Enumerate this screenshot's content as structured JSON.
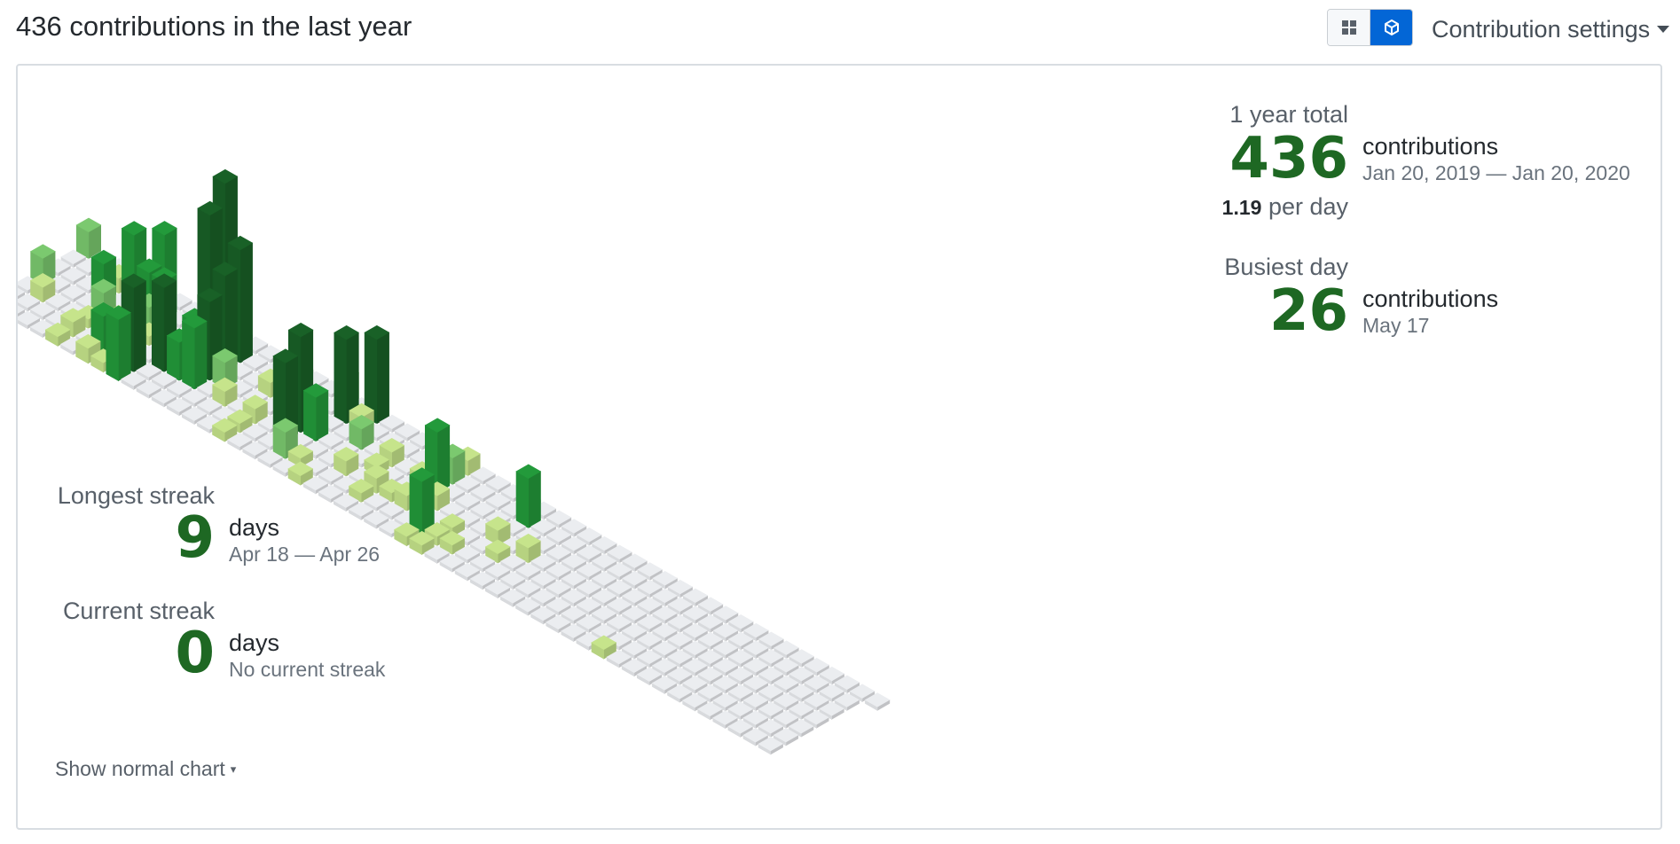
{
  "header": {
    "title": "436 contributions in the last year",
    "settings_label": "Contribution settings",
    "view_toggle": {
      "active": "isometric"
    }
  },
  "summary": {
    "year_label": "1 year total",
    "year_total": "436",
    "year_unit": "contributions",
    "year_range": "Jan 20, 2019 — Jan 20, 2020",
    "per_day_value": "1.19",
    "per_day_suffix": "per day",
    "busiest_label": "Busiest day",
    "busiest_count": "26",
    "busiest_unit": "contributions",
    "busiest_date": "May 17"
  },
  "streaks": {
    "longest_label": "Longest streak",
    "longest_value": "9",
    "longest_unit": "days",
    "longest_range": "Apr 18 — Apr 26",
    "current_label": "Current streak",
    "current_value": "0",
    "current_unit": "days",
    "current_sub": "No current streak"
  },
  "footer": {
    "show_normal_label": "Show normal chart"
  },
  "colors": {
    "empty": "#ebedf0",
    "level1": "#c6e48b",
    "level2": "#7bc96f",
    "level3": "#239a3b",
    "level4": "#196127",
    "accent": "#0366d6",
    "number": "#1e6823"
  },
  "chart_data": {
    "type": "isometric-3d-bar",
    "weeks": 53,
    "days": 7,
    "cells": [
      {
        "w": 0,
        "d": 0,
        "v": 4
      },
      {
        "w": 0,
        "d": 3,
        "v": 4
      },
      {
        "w": 1,
        "d": 4,
        "v": 2
      },
      {
        "w": 3,
        "d": 2,
        "v": 6
      },
      {
        "w": 3,
        "d": 1,
        "v": 2
      },
      {
        "w": 4,
        "d": 3,
        "v": 4
      },
      {
        "w": 4,
        "d": 4,
        "v": 1
      },
      {
        "w": 4,
        "d": 5,
        "v": 2
      },
      {
        "w": 4,
        "d": 6,
        "v": 1
      },
      {
        "w": 4,
        "d": 1,
        "v": 11
      },
      {
        "w": 5,
        "d": 0,
        "v": 11
      },
      {
        "w": 5,
        "d": 1,
        "v": 6
      },
      {
        "w": 5,
        "d": 3,
        "v": 1
      },
      {
        "w": 6,
        "d": 1,
        "v": 6
      },
      {
        "w": 6,
        "d": 2,
        "v": 3
      },
      {
        "w": 5,
        "d": 4,
        "v": 2
      },
      {
        "w": 6,
        "d": 4,
        "v": 3
      },
      {
        "w": 6,
        "d": 5,
        "v": 6
      },
      {
        "w": 6,
        "d": 6,
        "v": 2
      },
      {
        "w": 7,
        "d": 3,
        "v": 1
      },
      {
        "w": 7,
        "d": 4,
        "v": 2
      },
      {
        "w": 7,
        "d": 5,
        "v": 1
      },
      {
        "w": 7,
        "d": 6,
        "v": 1
      },
      {
        "w": 8,
        "d": 3,
        "v": 8
      },
      {
        "w": 8,
        "d": 5,
        "v": 14
      },
      {
        "w": 8,
        "d": 6,
        "v": 10
      },
      {
        "w": 9,
        "d": 0,
        "v": 26
      },
      {
        "w": 9,
        "d": 1,
        "v": 22
      },
      {
        "w": 9,
        "d": 4,
        "v": 14
      },
      {
        "w": 10,
        "d": 3,
        "v": 8
      },
      {
        "w": 10,
        "d": 4,
        "v": 6
      },
      {
        "w": 11,
        "d": 1,
        "v": 19
      },
      {
        "w": 11,
        "d": 2,
        "v": 16
      },
      {
        "w": 11,
        "d": 3,
        "v": 13
      },
      {
        "w": 11,
        "d": 4,
        "v": 10
      },
      {
        "w": 12,
        "d": 3,
        "v": 4
      },
      {
        "w": 13,
        "d": 4,
        "v": 2
      },
      {
        "w": 14,
        "d": 1,
        "v": 2
      },
      {
        "w": 14,
        "d": 2,
        "v": 2
      },
      {
        "w": 15,
        "d": 4,
        "v": 2
      },
      {
        "w": 15,
        "d": 5,
        "v": 1
      },
      {
        "w": 15,
        "d": 6,
        "v": 1
      },
      {
        "w": 17,
        "d": 0,
        "v": 4
      },
      {
        "w": 17,
        "d": 3,
        "v": 16
      },
      {
        "w": 17,
        "d": 4,
        "v": 13
      },
      {
        "w": 18,
        "d": 1,
        "v": 14
      },
      {
        "w": 18,
        "d": 3,
        "v": 7
      },
      {
        "w": 18,
        "d": 5,
        "v": 4
      },
      {
        "w": 19,
        "d": 0,
        "v": 14
      },
      {
        "w": 19,
        "d": 1,
        "v": 2
      },
      {
        "w": 19,
        "d": 5,
        "v": 1
      },
      {
        "w": 20,
        "d": 2,
        "v": 3
      },
      {
        "w": 20,
        "d": 6,
        "v": 1
      },
      {
        "w": 21,
        "d": 4,
        "v": 2
      },
      {
        "w": 22,
        "d": 2,
        "v": 2
      },
      {
        "w": 22,
        "d": 3,
        "v": 1
      },
      {
        "w": 23,
        "d": 4,
        "v": 2
      },
      {
        "w": 23,
        "d": 5,
        "v": 1
      },
      {
        "w": 24,
        "d": 2,
        "v": 1
      },
      {
        "w": 24,
        "d": 4,
        "v": 1
      },
      {
        "w": 25,
        "d": 0,
        "v": 2
      },
      {
        "w": 25,
        "d": 1,
        "v": 4
      },
      {
        "w": 25,
        "d": 2,
        "v": 10
      },
      {
        "w": 25,
        "d": 4,
        "v": 2
      },
      {
        "w": 26,
        "d": 3,
        "v": 2
      },
      {
        "w": 27,
        "d": 5,
        "v": 9
      },
      {
        "w": 27,
        "d": 6,
        "v": 1
      },
      {
        "w": 28,
        "d": 4,
        "v": 1
      },
      {
        "w": 28,
        "d": 5,
        "v": 1
      },
      {
        "w": 28,
        "d": 6,
        "v": 1
      },
      {
        "w": 29,
        "d": 5,
        "v": 1
      },
      {
        "w": 30,
        "d": 1,
        "v": 8
      },
      {
        "w": 30,
        "d": 3,
        "v": 2
      },
      {
        "w": 31,
        "d": 4,
        "v": 1
      },
      {
        "w": 32,
        "d": 3,
        "v": 2
      },
      {
        "w": 40,
        "d": 6,
        "v": 1
      }
    ]
  }
}
